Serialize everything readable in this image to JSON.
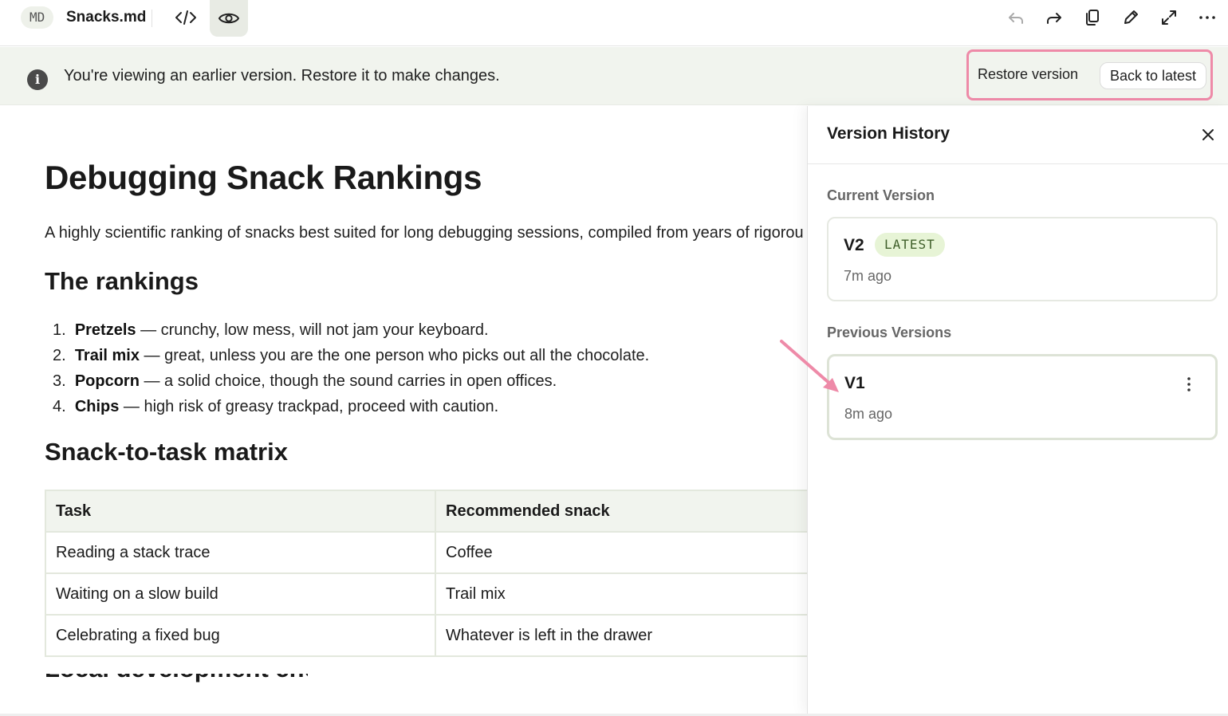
{
  "toolbar": {
    "file_type": "MD",
    "filename": "Snacks.md",
    "code_view_icon": "code-brackets-icon",
    "preview_icon": "eye-icon",
    "actions": [
      "undo-icon",
      "redo-icon",
      "copy-icon",
      "pencil-icon",
      "expand-icon",
      "more-horizontal-icon"
    ]
  },
  "banner": {
    "message": "You're viewing an earlier version. Restore it to make changes.",
    "restore_label": "Restore version",
    "back_label": "Back to latest"
  },
  "document": {
    "title": "Debugging Snack Rankings",
    "intro": "A highly scientific ranking of snacks best suited for long debugging sessions, compiled from years of rigorou",
    "rankings_heading": "The rankings",
    "rankings": [
      {
        "num": "1.",
        "name": "Pretzels",
        "desc": " — crunchy, low mess, will not jam your keyboard."
      },
      {
        "num": "2.",
        "name": "Trail mix",
        "desc": " — great, unless you are the one person who picks out all the chocolate."
      },
      {
        "num": "3.",
        "name": "Popcorn",
        "desc": " — a solid choice, though the sound carries in open offices."
      },
      {
        "num": "4.",
        "name": "Chips",
        "desc": " — high risk of greasy trackpad, proceed with caution."
      }
    ],
    "matrix_heading": "Snack-to-task matrix",
    "matrix": {
      "headers": [
        "Task",
        "Recommended snack"
      ],
      "rows": [
        [
          "Reading a stack trace",
          "Coffee"
        ],
        [
          "Waiting on a slow build",
          "Trail mix"
        ],
        [
          "Celebrating a fixed bug",
          "Whatever is left in the drawer"
        ]
      ]
    },
    "next_heading_partial": "Local development checklist"
  },
  "version_panel": {
    "title": "Version History",
    "current_label": "Current Version",
    "current": {
      "name": "V2",
      "badge": "LATEST",
      "time": "7m ago"
    },
    "previous_label": "Previous Versions",
    "previous": [
      {
        "name": "V1",
        "time": "8m ago"
      }
    ]
  },
  "colors": {
    "banner_bg": "#f1f4ee",
    "highlight": "#ee8aa8",
    "badge_bg": "#e7f4d6",
    "badge_text": "#3f5f2a"
  }
}
